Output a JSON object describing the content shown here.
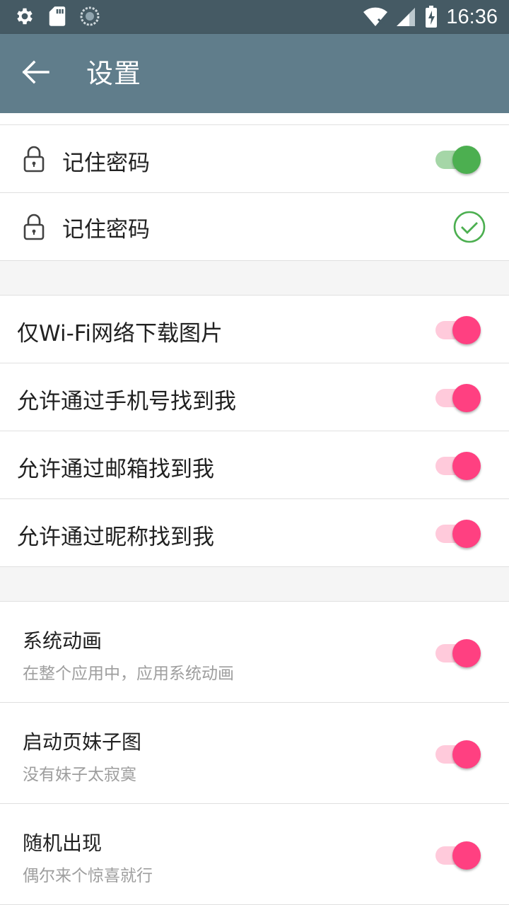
{
  "status_bar": {
    "time": "16:36",
    "left_icons": [
      "gear-icon",
      "sd-card-icon",
      "sync-icon"
    ],
    "right_icons": [
      "wifi-off-icon",
      "signal-icon",
      "battery-charging-icon"
    ]
  },
  "app_bar": {
    "title": "设置",
    "back_icon": "arrow-left-icon"
  },
  "colors": {
    "status_bar": "#455a64",
    "app_bar": "#607d8b",
    "green_accent": "#4caf50",
    "pink_accent": "#ff4081"
  },
  "section1": {
    "items": [
      {
        "label": "记住密码",
        "control": "switch",
        "checked": true,
        "color": "green"
      },
      {
        "label": "记住密码",
        "control": "checkbox",
        "checked": true,
        "color": "green"
      }
    ]
  },
  "section2": {
    "items": [
      {
        "label": "仅Wi-Fi网络下载图片",
        "checked": true
      },
      {
        "label": "允许通过手机号找到我",
        "checked": true
      },
      {
        "label": "允许通过邮箱找到我",
        "checked": true
      },
      {
        "label": "允许通过昵称找到我",
        "checked": true
      }
    ]
  },
  "section3": {
    "items": [
      {
        "title": "系统动画",
        "summary": "在整个应用中，应用系统动画",
        "checked": true
      },
      {
        "title": "启动页妹子图",
        "summary": "没有妹子太寂寞",
        "checked": true
      },
      {
        "title": "随机出现",
        "summary": "偶尔来个惊喜就行",
        "checked": true
      }
    ]
  }
}
